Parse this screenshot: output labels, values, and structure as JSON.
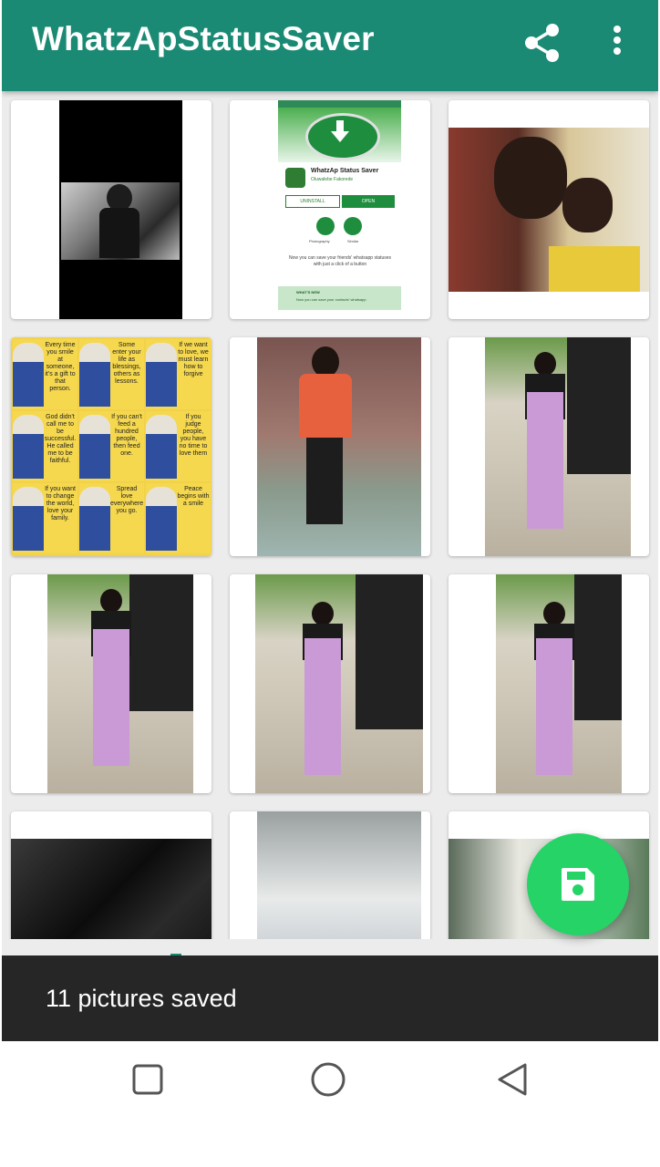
{
  "appbar": {
    "title": "WhatzApStatusSaver",
    "actions": [
      "share-icon",
      "more-vert-icon"
    ],
    "color": "#1b8a74"
  },
  "grid": {
    "thumb1_inner": {
      "app_name": "WhatzAp Status Saver",
      "developer": "Oluwalebe Fakorede",
      "uninstall_label": "UNINSTALL",
      "open_label": "OPEN",
      "category1": "Photography",
      "category2": "Similar",
      "description": "Now you can save your friends' whatsapp statuses with just a click of a button",
      "whats_new": "WHAT'S NEW",
      "whats_new_text": "Now you can save your contacts' whatsapp"
    },
    "quote_tiles": [
      "Every time you smile at someone, it's a gift to that person.",
      "Some enter your life as blessings, others as lessons.",
      "If we want to love, we must learn how to forgive",
      "God didn't call me to be successful. He called me to be faithful.",
      "If you can't feed a hundred people, then feed one.",
      "If you judge people, you have no time to love them",
      "If you want to change the world, love your family.",
      "Spread love everywhere you go.",
      "Peace begins with a smile"
    ]
  },
  "fab": {
    "icon": "save-icon",
    "color": "#25d366"
  },
  "snackbar": {
    "text": "11 pictures saved"
  },
  "navbar": {
    "buttons": [
      "recents-square-icon",
      "home-circle-icon",
      "back-triangle-icon"
    ]
  }
}
